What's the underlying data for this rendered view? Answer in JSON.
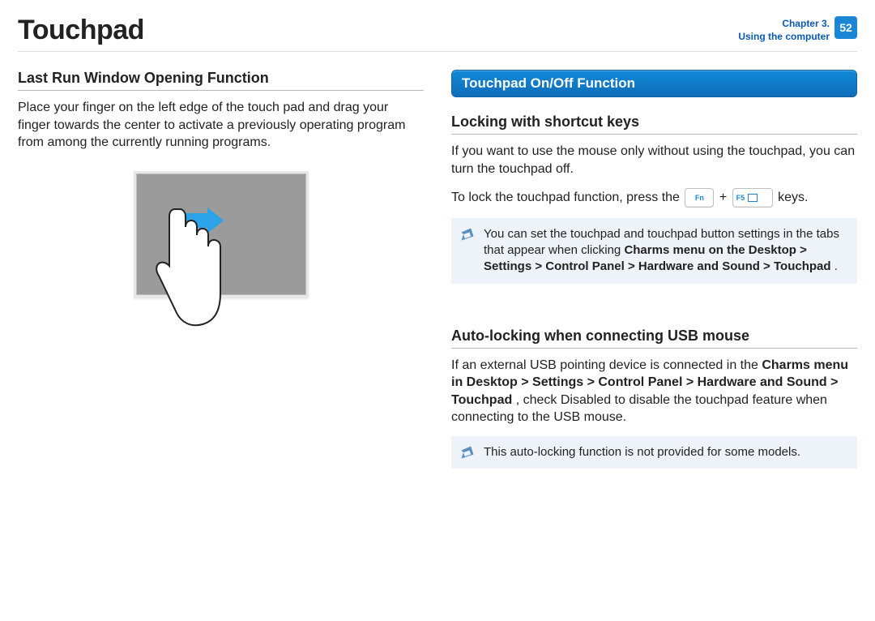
{
  "header": {
    "title": "Touchpad",
    "chapter_line1": "Chapter 3.",
    "chapter_line2": "Using the computer",
    "page_number": "52"
  },
  "left": {
    "h2": "Last Run Window Opening Function",
    "p1": "Place your finger on the left edge of the touch pad and drag your finger towards the center to activate a previously operating program from among the currently running programs."
  },
  "right": {
    "section_bar": "Touchpad On/Off Function",
    "h2a": "Locking with shortcut keys",
    "p1": "If you want to use the mouse only without using the touchpad, you can turn the touchpad off.",
    "lock_pre": "To lock the touchpad function, press the ",
    "key1": "Fn",
    "plus": "+",
    "key2": "F5",
    "lock_post": " keys.",
    "note1_a": "You can set the touchpad and touchpad button settings in the tabs that appear when clicking ",
    "note1_b": "Charms menu on the Desktop > Settings > Control Panel > Hardware and Sound > Touchpad",
    "note1_c": ".",
    "h2b": "Auto-locking when connecting USB mouse",
    "p2a": "If an external USB pointing device is connected in the ",
    "p2b": "Charms menu in Desktop > Settings > Control Panel > Hardware and Sound > Touchpad",
    "p2c": ", check Disabled to disable the touchpad feature when connecting to the USB mouse.",
    "note2": "This auto-locking function is not provided for some models."
  }
}
